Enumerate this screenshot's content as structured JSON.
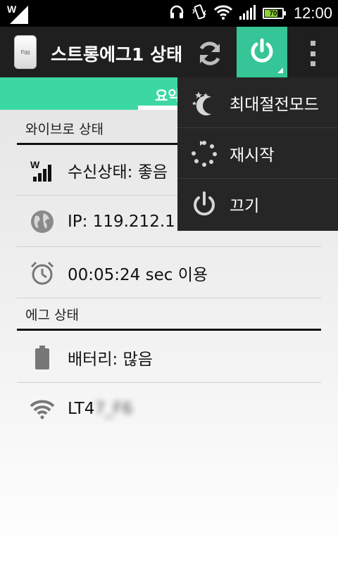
{
  "status_bar": {
    "time": "12:00",
    "battery_level": "70",
    "colors": {
      "battery_fill": "#8ad334"
    },
    "icons": [
      "carrier-w-icon",
      "headset-icon",
      "vibrate-icon",
      "wifi-icon",
      "signal-icon",
      "battery-icon"
    ]
  },
  "action_bar": {
    "title": "스트롱에그1 상태",
    "app_icon_label": "Egg",
    "icons": [
      "app-icon",
      "refresh-icon",
      "power-icon",
      "overflow-menu-icon"
    ],
    "colors": {
      "background": "#1f1f1f",
      "power_accent": "#35c596"
    }
  },
  "tabs": {
    "active_label": "요약",
    "colors": {
      "background": "#3cd8a4"
    }
  },
  "sections": [
    {
      "title": "와이브로 상태",
      "rows": [
        {
          "icon": "wibro-signal-icon",
          "text": "수신상태: 좋음"
        },
        {
          "icon": "globe-icon",
          "text": "IP: 119.212.1"
        },
        {
          "icon": "alarm-clock-icon",
          "text": "00:05:24 sec 이용"
        }
      ]
    },
    {
      "title": "에그 상태",
      "rows": [
        {
          "icon": "battery-status-icon",
          "text": "배터리: 많음"
        },
        {
          "icon": "wifi-status-icon",
          "text": "LT4",
          "blurred_suffix": "7_F6"
        }
      ]
    }
  ],
  "menu": {
    "items": [
      {
        "icon": "moon-stars-icon",
        "label": "최대절전모드"
      },
      {
        "icon": "restart-icon",
        "label": "재시작"
      },
      {
        "icon": "power-off-icon",
        "label": "끄기"
      }
    ]
  }
}
